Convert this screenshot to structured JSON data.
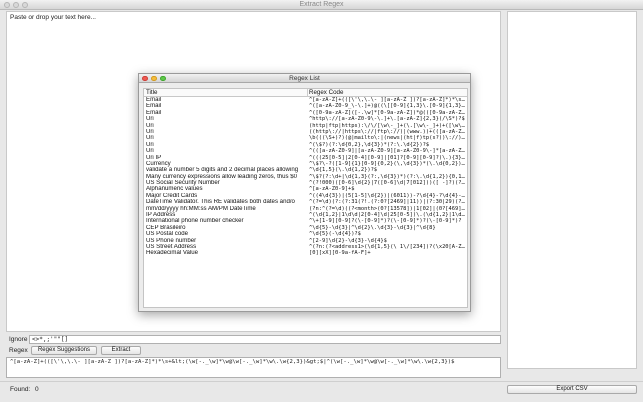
{
  "window": {
    "title": "Extract Regex"
  },
  "main": {
    "placeholder": "Paste or drop your text here...",
    "ignore_label": "Ignore",
    "ignore_value": "<>*,;'\"\"[]",
    "regex_label": "Regex",
    "suggestions_button": "Regex Suggestions",
    "extract_button": "Extract",
    "regex_value": "^[a-zA-Z]+(([\\'\\,\\.\\- ][a-zA-Z ])?[a-zA-Z]*)*\\s+&lt;(\\w[-._\\w]*\\w@\\w[-._\\w]*\\w\\.\\w{2,3})&gt;$|^(\\w[-._\\w]*\\w@\\w[-._\\w]*\\w\\.\\w{2,3})$",
    "found_label": "Found:",
    "found_count": "0",
    "export_button": "Export CSV"
  },
  "dialog": {
    "title": "Regex List",
    "columns": {
      "title": "Title",
      "code": "Regex Code"
    },
    "rows": [
      {
        "title": "Email",
        "code": "^[a-zA-Z]+(([\\'\\,\\.\\- ][a-zA-Z ])?[a-zA-Z]*)*\\s+&lt;(\\w["
      },
      {
        "title": "Email",
        "code": "^([a-zA-Z0-9_\\-\\.]+)@((\\[[0-9]{1,3}\\.[0-9]{1,3}\\.[0-9]{1"
      },
      {
        "title": "Email",
        "code": "^([0-9a-zA-Z]([-.\\w]*[0-9a-zA-Z])*@(([0-9a-zA-Z])+([-"
      },
      {
        "title": "Uri",
        "code": "^http\\://[a-zA-Z0-9\\-\\.]+\\.[a-zA-Z]{2,3}(/\\S*)?$"
      },
      {
        "title": "Uri",
        "code": "(http|ftp|https):\\/\\/[\\w\\-_]+(\\.[\\w\\-_]+)+([\\w\\-\\.,@?^="
      },
      {
        "title": "Uri",
        "code": "((http\\://|https\\://|ftp\\://)|(www.))+(([a-zA-Z0-9\\.-]+"
      },
      {
        "title": "Uri",
        "code": "\\b(((\\S+)?)(@|mailto\\:|(news|(ht|f)tp(s?))\\://)\\S+)\\b"
      },
      {
        "title": "Uri",
        "code": "^(\\$?)(?:\\d{0,2},\\d{3})*(?:\\.\\d{2})?$"
      },
      {
        "title": "Uri",
        "code": "^(([a-zA-Z0-9]|[a-zA-Z0-9][a-zA-Z0-9\\-]*[a-zA-Z0-9])\\.)"
      },
      {
        "title": "Uri IP",
        "code": "^(((25[0-5]|2[0-4][0-9]|[01]?[0-9][0-9]?)\\.){3}(25[0-5]"
      },
      {
        "title": "Currency",
        "code": "^\\$?\\-?([1-9]{1}[0-9]{0,2}(\\,\\d{3})*(\\.\\d{0,2})?|[1-9]"
      },
      {
        "title": "validate a number 5 digits and 2 decimal places allowing",
        "code": "^\\d{1,5}(\\.\\d{1,2})?$"
      },
      {
        "title": "Many currency expressions allow leading zeros, thus $0",
        "code": "^\\$?(?:\\d+|\\d{1,3}(?:,\\d{3})*)(?:\\.\\d{1,2}){0,1}$"
      },
      {
        "title": "US Social Security Number",
        "code": "^(?!000)([0-6]\\d{2}|7([0-6]\\d|7[012]))([ -]?)(?!00)\\d\\d\\3"
      },
      {
        "title": "Alphanumeric values",
        "code": "^[a-zA-Z0-9]+$"
      },
      {
        "title": "Major Credit Cards",
        "code": "^((4\\d{3})|(5[1-5]\\d{2})|(6011))-?\\d{4}-?\\d{4}-?\\d{4}"
      },
      {
        "title": "DateTime Validator. This RE validates both dates and/o",
        "code": "^(?=\\d)(?:(?:31(?!.(?:0?[2469]|11))|(?:30|29)(?!.0?2)"
      },
      {
        "title": "mm/dd/yyyy hh:MM:ss AM/PM DateTime",
        "code": "(?n:^(?=\\d)((?<month>(0?[13578])|1[02]|(0?[469]|11)"
      },
      {
        "title": "IP Address",
        "code": "^(\\d{1,2}|1\\d\\d|2[0-4]\\d|25[0-5])\\.(\\d{1,2}|1\\d\\d|2"
      },
      {
        "title": "International phone number checker",
        "code": "^\\+[1-9][0-9]?(\\-[0-9]*)?(\\-[0-9]*)?(\\-[0-9]*)?"
      },
      {
        "title": "CEP Brasileiro",
        "code": "^\\d{5}-\\d{3}|^\\d{2}\\.\\d{3}-\\d{3}|^\\d{8}"
      },
      {
        "title": "US Postal code",
        "code": "^\\d{5}(-\\d{4})?$"
      },
      {
        "title": "US Phone number",
        "code": "^[2-9]\\d{2}-\\d{3}-\\d{4}$"
      },
      {
        "title": "US Street Address",
        "code": "^(?n:(?<address1>(\\d{1,5}(\\ 1\\/[234])?(\\x20[A-Z]([a"
      },
      {
        "title": "Hexadecimal Value",
        "code": "[0][xX][0-9a-fA-F]+"
      }
    ]
  }
}
